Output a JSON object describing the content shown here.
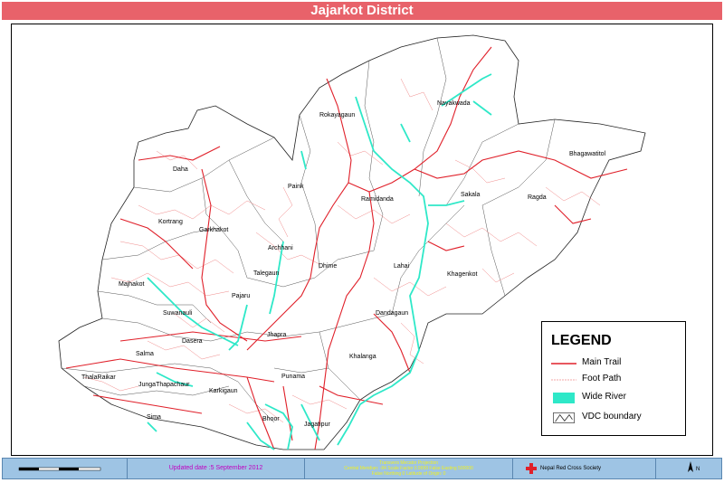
{
  "title": "Jajarkot District",
  "vdcs": [
    {
      "name": "Rokayagaun"
    },
    {
      "name": "Nayakwada"
    },
    {
      "name": "Bhagawatitol"
    },
    {
      "name": "Daha"
    },
    {
      "name": "Paink"
    },
    {
      "name": "Ramidanda"
    },
    {
      "name": "Sakala"
    },
    {
      "name": "Ragda"
    },
    {
      "name": "Kortrang"
    },
    {
      "name": "Garkhakot"
    },
    {
      "name": "Archhani"
    },
    {
      "name": "Dhime"
    },
    {
      "name": "Lahai"
    },
    {
      "name": "Talegaun"
    },
    {
      "name": "Khagenkot"
    },
    {
      "name": "Majhakot"
    },
    {
      "name": "Pajaru"
    },
    {
      "name": "Suwanauli"
    },
    {
      "name": "Dandagaun"
    },
    {
      "name": "Dasera"
    },
    {
      "name": "Jhapra"
    },
    {
      "name": "Salma"
    },
    {
      "name": "Khalanga"
    },
    {
      "name": "ThalaRaikar"
    },
    {
      "name": "JungaThapachaur"
    },
    {
      "name": "Punama"
    },
    {
      "name": "Karkigaun"
    },
    {
      "name": "Sima"
    },
    {
      "name": "Bhoor"
    },
    {
      "name": "Jagatipur"
    }
  ],
  "legend": {
    "title": "LEGEND",
    "items": [
      {
        "label": "Main Trail",
        "color": "#e0202a"
      },
      {
        "label": "Foot Path",
        "color": "#f08a8a"
      },
      {
        "label": "Wide River",
        "color": "#2ee8c8"
      },
      {
        "label": "VDC boundary",
        "color": "#333333"
      }
    ]
  },
  "footer": {
    "updated": "Updated date :5 September 2012",
    "projection_title": "Transvers Mecator Projection",
    "projection_line1": "Central Meridian: -84 Scale Factor 0.9999 False Easting 500000",
    "projection_line2": "False Northing 0 Latitude of Origin: 0",
    "organization": "Nepal Red Cross Society",
    "north": "N"
  },
  "colors": {
    "title_bar": "#e8626a",
    "footer_bg": "#9ec4e4",
    "main_trail": "#e0202a",
    "foot_path": "#f08a8a",
    "river": "#2ee8c8"
  }
}
